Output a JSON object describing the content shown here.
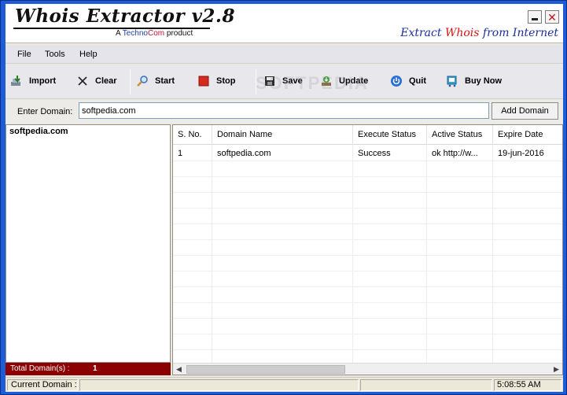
{
  "app": {
    "title": "Whois Extractor  v2.8",
    "byline_prefix": "A",
    "byline_techno": "Techno",
    "byline_com": "Com",
    "byline_suffix": "product",
    "tagline_pre": "Extract",
    "tagline_whois": "Whois",
    "tagline_post": "from Internet",
    "accent": "#1e5bd6"
  },
  "window_controls": {
    "minimize_icon": "minimize-icon",
    "close_icon": "close-icon",
    "close_glyph": "✕"
  },
  "menu": {
    "items": [
      "File",
      "Tools",
      "Help"
    ]
  },
  "toolbar": {
    "import_label": "Import",
    "clear_label": "Clear",
    "start_label": "Start",
    "stop_label": "Stop",
    "save_label": "Save",
    "update_label": "Update",
    "quit_label": "Quit",
    "buynow_label": "Buy Now",
    "watermark": "SOFTPEDIA"
  },
  "entry": {
    "label": "Enter Domain:",
    "value": "softpedia.com",
    "add_button": "Add Domain"
  },
  "left_panel": {
    "items": [
      "softpedia.com"
    ],
    "total_label": "Total Domain(s) :",
    "total_count": "1",
    "total_color": "#8b0000"
  },
  "grid": {
    "columns": [
      "S. No.",
      "Domain Name",
      "Execute Status",
      "Active Status",
      "Expire Date"
    ],
    "rows": [
      [
        "1",
        "softpedia.com",
        "Success",
        "ok http://w...",
        "19-jun-2016"
      ]
    ]
  },
  "status_bar": {
    "current_domain_label": "Current Domain :",
    "current_domain_value": "",
    "time": "5:08:55 AM"
  }
}
